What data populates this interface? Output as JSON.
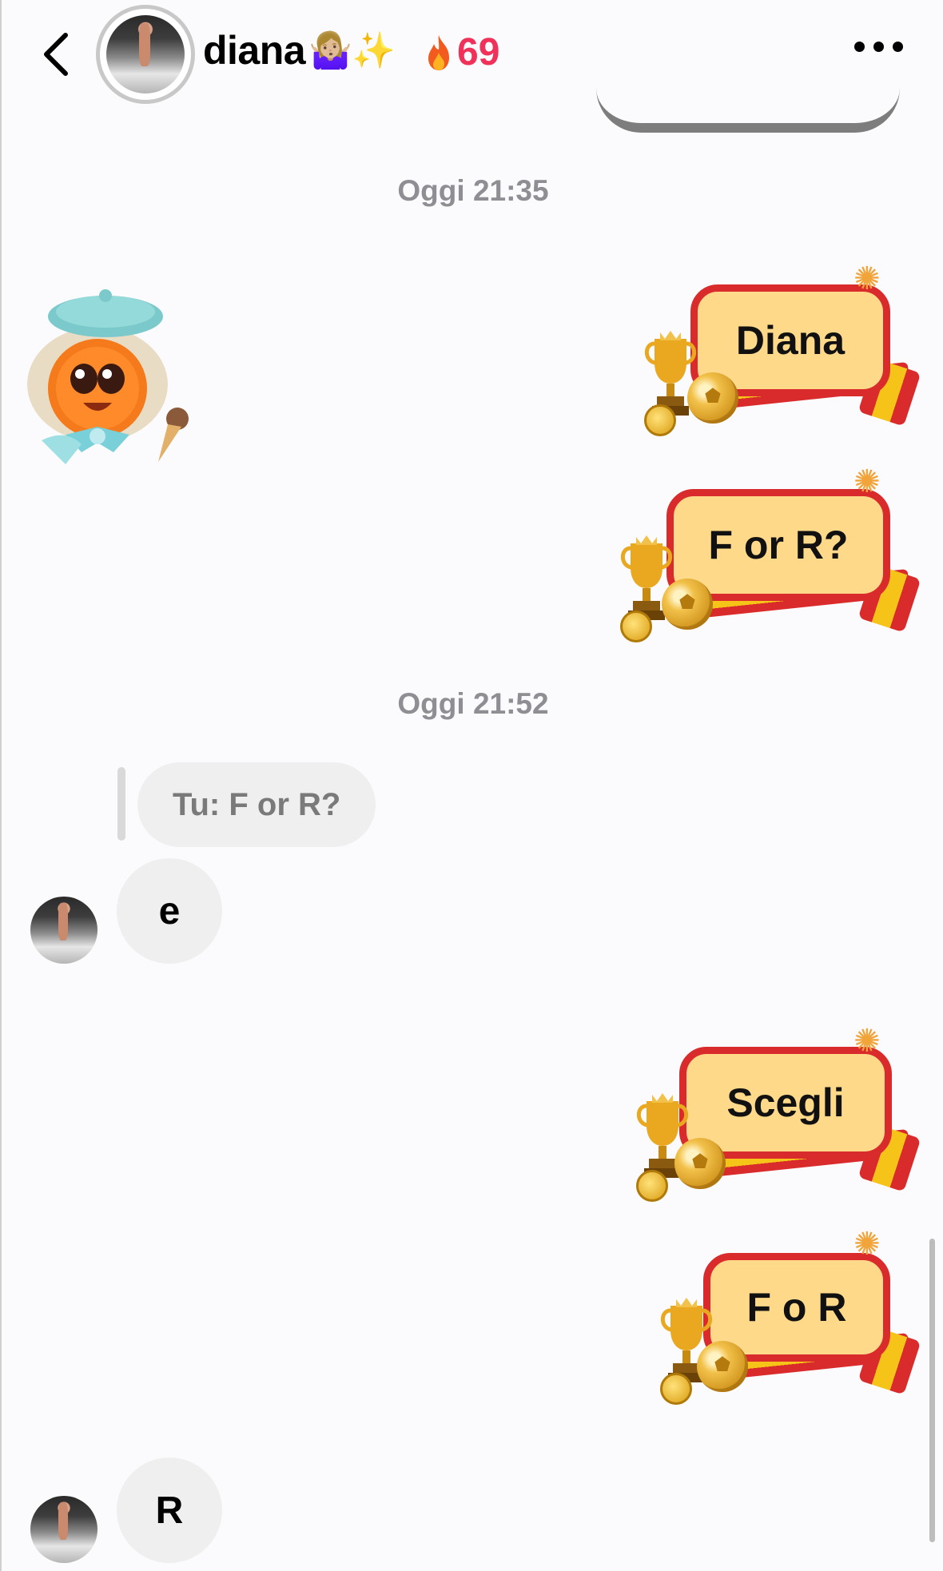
{
  "header": {
    "contact_name": "diana",
    "name_emoji": "🤷🏼‍♀️✨",
    "streak_count": "69",
    "back_icon": "chevron-left-icon",
    "more_icon": "more-horizontal-icon"
  },
  "conversation": {
    "timestamps": [
      "Oggi 21:35",
      "Oggi 21:52"
    ],
    "stickers": [
      {
        "text": "Diana"
      },
      {
        "text": "F or R?"
      },
      {
        "text": "Scegli"
      },
      {
        "text": "F o R"
      }
    ],
    "reply_preview": "Tu: F or R?",
    "incoming_messages": [
      "e",
      "R"
    ]
  },
  "colors": {
    "streak": "#f0325b",
    "timestamp": "#8e8e93",
    "sticker_border": "#d92b2b",
    "sticker_fill": "#ffd98a",
    "bubble": "#efefef"
  }
}
